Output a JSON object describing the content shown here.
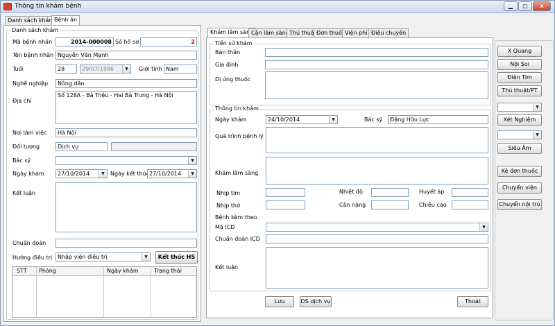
{
  "window": {
    "title": "Thông tin khám bệnh",
    "controls": [
      "▁",
      "▢",
      "x"
    ]
  },
  "left_tabs": [
    "Danh sách khám",
    "Bệnh án"
  ],
  "left": {
    "group_label": "Danh sách khám",
    "ma_benh_nhan_label": "Mã bệnh nhân",
    "ma_benh_nhan_value": "2014-000008",
    "so_ho_so_label": "Số hồ sơ",
    "so_ho_so_value": "2",
    "ten_benh_nhan_label": "Tên bệnh nhân",
    "ten_benh_nhan_value": "Nguyễn Văn Mạnh",
    "tuoi_label": "Tuổi",
    "tuoi_value": "28",
    "ngay_sinh_value": "29/07/1986",
    "gioi_tinh_label": "Giới tính",
    "gioi_tinh_value": "Nam",
    "nghe_nghiep_label": "Nghề nghiệp",
    "nghe_nghiep_value": "Nông dân",
    "dia_chi_label": "Địa chỉ",
    "dia_chi_value": "Số 128A  - Bà Triệu  - Hai Bà Trưng - Hà Nội",
    "noi_lam_viec_label": "Nơi làm việc",
    "noi_lam_viec_value": "Hà Nội",
    "doi_tuong_label": "Đối tượng",
    "doi_tuong_value": "Dịch vụ",
    "bac_sy_label": "Bác sỹ",
    "ngay_kham_label": "Ngày khám",
    "ngay_kham_value": "27/10/2014",
    "ngay_ket_thuc_label": "Ngày kết thúc",
    "ngay_ket_thuc_value": "27/10/2014",
    "ket_luan_label": "Kết luận",
    "chuan_doan_label": "Chuẩn đoán",
    "huong_dieu_tri_label": "Hướng điều trị",
    "huong_dieu_tri_value": "Nhập viện điều trị",
    "ket_thuc_button": "Kết thúc HS",
    "table_headers": [
      "STT",
      "Phòng",
      "Ngày khám",
      "Trạng thái"
    ]
  },
  "right_tabs": [
    "Khám lâm sàng",
    "Cận lâm sàng",
    "Thủ thuật",
    "Đơn thuốc",
    "Viện phí",
    "Điều chuyển"
  ],
  "tien_su": {
    "group_label": "Tiền sử khám",
    "ban_than_label": "Bản thân",
    "gia_dinh_label": "Gia đình",
    "di_ung_label": "Dị ứng thuốc"
  },
  "thong_tin": {
    "group_label": "Thông tin khám",
    "ngay_kham_label": "Ngày khám",
    "ngay_kham_value": "24/10/2014",
    "bac_sy_label": "Bác sỹ",
    "bac_sy_value": "Đặng Hữu Lực",
    "qua_trinh_label": "Quá trình bệnh lý",
    "kham_lam_sang_label": "Khám lâm sàng",
    "nhip_tim_label": "Nhịp tim",
    "nhiet_do_label": "Nhiệt độ",
    "huyet_ap_label": "Huyết áp",
    "nhip_tho_label": "Nhịp thở",
    "can_nang_label": "Cân nặng",
    "chieu_cao_label": "Chiều cao",
    "benh_kem_theo_label": "Bệnh kèm theo",
    "ma_icd_label": "Mã ICD",
    "chuan_doan_icd_label": "Chuẩn đoán ICD",
    "ket_luan_label": "Kết luận"
  },
  "bottom_buttons": {
    "luu": "Lưu",
    "ds_dich_vu": "DS dịch vụ",
    "thoat": "Thoát"
  },
  "side_buttons": {
    "x_quang": "X Quang",
    "noi_soi": "Nội Soi",
    "dien_tim": "Điện Tim",
    "thu_thuat": "Thủ thuật/PT",
    "xet_nghiem": "Xét Nghiệm",
    "sieu_am": "Siêu Âm",
    "ke_don_thuoc": "Kê đơn thuốc",
    "chuyen_vien": "Chuyển viện",
    "chuyen_noi_tru": "Chuyển nội trú"
  },
  "colors": {
    "accent_red": "#cc0000",
    "border": "#7f9db9"
  }
}
